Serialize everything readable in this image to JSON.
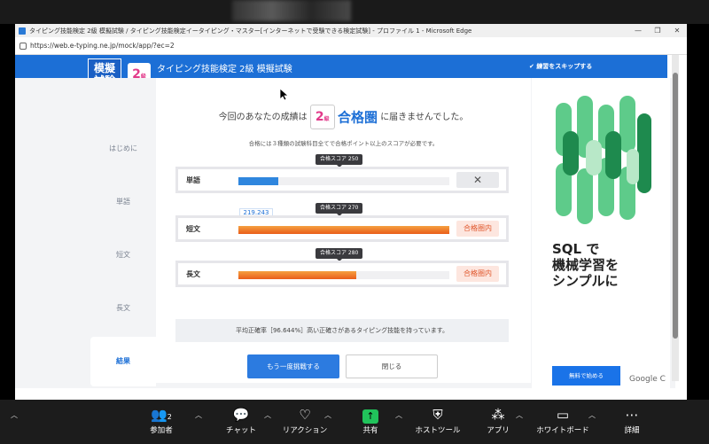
{
  "window": {
    "title": "タイピング技能検定 2級 模擬試験 / タイピング技能検定イータイピング・マスター[インターネットで受験できる検定試験] - プロファイル 1 - Microsoft Edge",
    "url": "https://web.e-typing.ne.jp/mock/app/?ec=2"
  },
  "header": {
    "logo": [
      "模擬",
      "試験"
    ],
    "level": "2",
    "level_suffix": "級",
    "title": "タイピング技能検定 2級 模擬試験",
    "skip_label": "練習をスキップする"
  },
  "sidebar": {
    "items": [
      {
        "label": "はじめに"
      },
      {
        "label": "単語"
      },
      {
        "label": "短文"
      },
      {
        "label": "長文"
      },
      {
        "label": "結果"
      }
    ]
  },
  "result": {
    "prefix": "今回のあなたの成績は",
    "pass_word": "合格圏",
    "suffix": "に届きませんでした。",
    "note": "合格には３種類の試験科目全てで合格ポイント以上のスコアが必要です。",
    "rows": [
      {
        "label": "単語",
        "pass_score_label": "合格スコア 250",
        "status": "✕",
        "progress": 0.19,
        "score": "219.243"
      },
      {
        "label": "短文",
        "pass_score_label": "合格スコア 270",
        "status": "合格圏内",
        "progress": 1.0
      },
      {
        "label": "長文",
        "pass_score_label": "合格スコア 280",
        "status": "合格圏内",
        "progress": 0.56
      }
    ],
    "accuracy": "平均正確率［96.644%］高い正確さがあるタイピング技能を持っています。",
    "retry_label": "もう一度挑戦する",
    "close_label": "閉じる"
  },
  "ad": {
    "headline": [
      "SQL で",
      "機械学習を",
      "シンプルに"
    ],
    "button": "無料で始める",
    "brand": "Google C"
  },
  "zoom": {
    "participants_label": "参加者",
    "participants_count": "2",
    "chat": "チャット",
    "reaction": "リアクション",
    "share": "共有",
    "host_tools": "ホストツール",
    "apps": "アプリ",
    "whiteboard": "ホワイトボード",
    "more": "詳細"
  }
}
